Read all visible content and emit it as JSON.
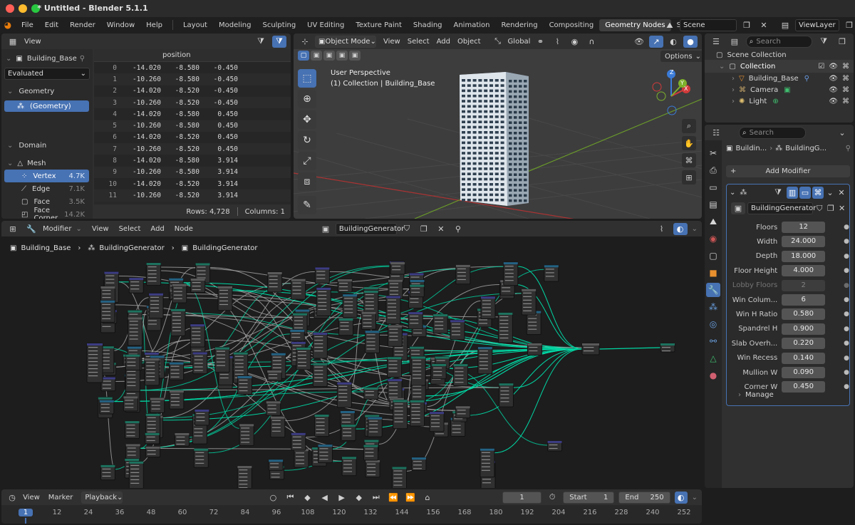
{
  "window": {
    "title": "* Untitled - Blender 5.1.1"
  },
  "menu": [
    "File",
    "Edit",
    "Render",
    "Window",
    "Help"
  ],
  "workspaces": [
    "Layout",
    "Modeling",
    "Sculpting",
    "UV Editing",
    "Texture Paint",
    "Shading",
    "Animation",
    "Rendering",
    "Compositing",
    "Geometry Nodes",
    "Scripting"
  ],
  "active_workspace": "Geometry Nodes",
  "add_workspace": "+",
  "scene": {
    "name": "Scene",
    "view_layer": "ViewLayer"
  },
  "spreadsheet": {
    "view_menu": "View",
    "object": "Building_Base",
    "evaluated": "Evaluated",
    "geometry_label": "Geometry",
    "geometry_item": "(Geometry)",
    "domain_label": "Domain",
    "mesh_label": "Mesh",
    "domains": [
      {
        "name": "Vertex",
        "count": "4.7K",
        "active": true
      },
      {
        "name": "Edge",
        "count": "7.1K",
        "active": false
      },
      {
        "name": "Face",
        "count": "3.5K",
        "active": false
      },
      {
        "name": "Face Corner",
        "count": "14.2K",
        "active": false
      }
    ],
    "column": "position",
    "rows": [
      [
        "0",
        "-14.020",
        "-8.580",
        "-0.450"
      ],
      [
        "1",
        "-10.260",
        "-8.580",
        "-0.450"
      ],
      [
        "2",
        "-14.020",
        "-8.520",
        "-0.450"
      ],
      [
        "3",
        "-10.260",
        "-8.520",
        "-0.450"
      ],
      [
        "4",
        "-14.020",
        "-8.580",
        "0.450"
      ],
      [
        "5",
        "-10.260",
        "-8.580",
        "0.450"
      ],
      [
        "6",
        "-14.020",
        "-8.520",
        "0.450"
      ],
      [
        "7",
        "-10.260",
        "-8.520",
        "0.450"
      ],
      [
        "8",
        "-14.020",
        "-8.580",
        "3.914"
      ],
      [
        "9",
        "-10.260",
        "-8.580",
        "3.914"
      ],
      [
        "10",
        "-14.020",
        "-8.520",
        "3.914"
      ],
      [
        "11",
        "-10.260",
        "-8.520",
        "3.914"
      ]
    ],
    "footer_rows": "Rows: 4,728",
    "footer_cols": "Columns: 1"
  },
  "viewport": {
    "mode": "Object Mode",
    "menus": [
      "View",
      "Select",
      "Add",
      "Object"
    ],
    "transform": "Global",
    "options": "Options",
    "perspective": "User Perspective",
    "collection_info": "(1) Collection | Building_Base",
    "axes": {
      "x": "X",
      "y": "Y",
      "z": "Z"
    }
  },
  "outliner": {
    "search_placeholder": "Search",
    "scene_collection": "Scene Collection",
    "collection": "Collection",
    "items": [
      "Building_Base",
      "Camera",
      "Light"
    ]
  },
  "properties": {
    "search_placeholder": "Search",
    "breadcrumb_obj": "Buildin...",
    "breadcrumb_mod": "BuildingG...",
    "add_modifier": "Add Modifier",
    "modifier_name": "BuildingGenerator",
    "params": [
      {
        "label": "Floors",
        "value": "12",
        "enabled": true
      },
      {
        "label": "Width",
        "value": "24.000",
        "enabled": true
      },
      {
        "label": "Depth",
        "value": "18.000",
        "enabled": true
      },
      {
        "label": "Floor Height",
        "value": "4.000",
        "enabled": true
      },
      {
        "label": "Lobby Floors",
        "value": "2",
        "enabled": false
      },
      {
        "label": "Win Colum...",
        "value": "6",
        "enabled": true
      },
      {
        "label": "Win H Ratio",
        "value": "0.580",
        "enabled": true
      },
      {
        "label": "Spandrel H",
        "value": "0.900",
        "enabled": true
      },
      {
        "label": "Slab Overh...",
        "value": "0.220",
        "enabled": true
      },
      {
        "label": "Win Recess",
        "value": "0.140",
        "enabled": true
      },
      {
        "label": "Mullion W",
        "value": "0.090",
        "enabled": true
      },
      {
        "label": "Corner W",
        "value": "0.450",
        "enabled": true
      }
    ],
    "manage": "Manage"
  },
  "node_editor": {
    "editor_type": "Modifier",
    "menus": [
      "View",
      "Select",
      "Add",
      "Node"
    ],
    "node_group": "BuildingGenerator",
    "breadcrumb": [
      "Building_Base",
      "BuildingGenerator",
      "BuildingGenerator"
    ]
  },
  "timeline": {
    "menus": [
      "View",
      "Marker",
      "Playback"
    ],
    "current_frame": "1",
    "start_label": "Start",
    "start": "1",
    "end_label": "End",
    "end": "250",
    "ticks": [
      "1",
      "12",
      "24",
      "36",
      "48",
      "60",
      "72",
      "84",
      "96",
      "108",
      "120",
      "132",
      "144",
      "156",
      "168",
      "180",
      "192",
      "204",
      "216",
      "228",
      "240",
      "252"
    ]
  },
  "colors": {
    "accent": "#4772b3",
    "geometry_link": "#00d6a3",
    "window_bg": "#303030"
  }
}
